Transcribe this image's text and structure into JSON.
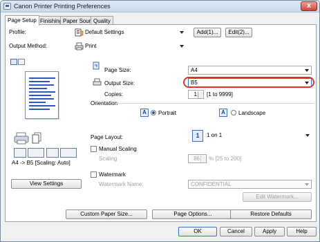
{
  "window": {
    "title": "Canon Printer Printing Preferences",
    "close_glyph": "x"
  },
  "tabs": [
    {
      "label": "Page Setup"
    },
    {
      "label": "Finishing"
    },
    {
      "label": "Paper Source"
    },
    {
      "label": "Quality"
    }
  ],
  "profile": {
    "label": "Profile:",
    "value": "Default Settings",
    "add_button": "Add(1)...",
    "edit_button": "Edit(2)..."
  },
  "output_method": {
    "label": "Output Method:",
    "value": "Print"
  },
  "preview": {
    "status": "A4 -> B5 [Scaling: Auto]",
    "view_settings_button": "View Settings"
  },
  "page_size": {
    "label": "Page Size:",
    "value": "A4"
  },
  "output_size": {
    "label": "Output Size:",
    "value": "B5"
  },
  "copies": {
    "label": "Copies:",
    "value": "1",
    "range": "[1 to 9999]"
  },
  "orientation": {
    "label": "Orientation",
    "portrait": "Portrait",
    "landscape": "Landscape",
    "portrait_glyph": "A",
    "landscape_glyph": "A"
  },
  "page_layout": {
    "label": "Page Layout:",
    "value": "1 on 1",
    "badge": "1"
  },
  "manual_scaling": {
    "label": "Manual Scaling",
    "scaling_label": "Scaling",
    "value": "86",
    "range": "% [25 to 200]"
  },
  "watermark": {
    "label": "Watermark",
    "name_label": "Watermark Name:",
    "value": "CONFIDENTIAL",
    "edit_button": "Edit Watermark..."
  },
  "bottom_buttons": {
    "custom_paper": "Custom Paper Size...",
    "page_options": "Page Options...",
    "restore": "Restore Defaults"
  },
  "dialog_buttons": {
    "ok": "OK",
    "cancel": "Cancel",
    "apply": "Apply",
    "help": "Help"
  },
  "colors": {
    "accent": "#2b57c7",
    "highlight": "#e0312b",
    "tab_border": "#9aa3ad"
  }
}
